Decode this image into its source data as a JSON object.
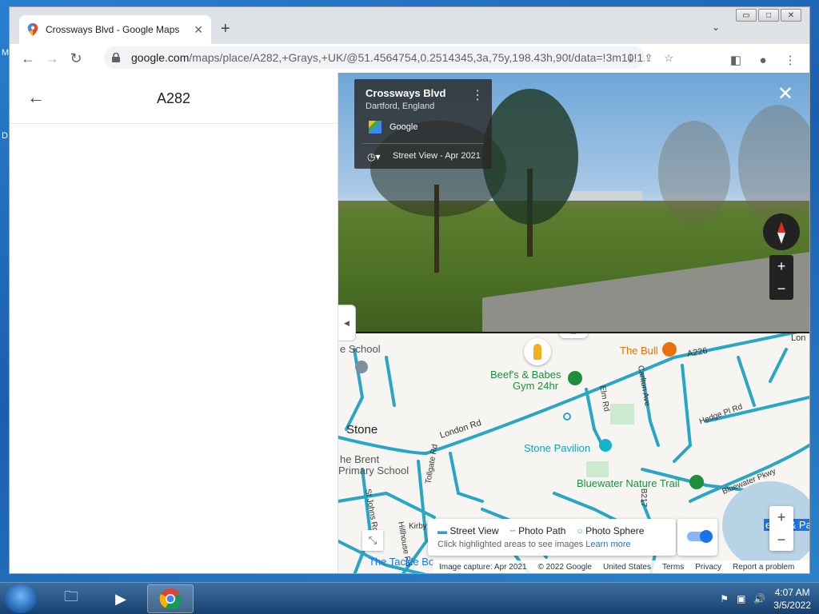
{
  "desktop": {
    "letters": [
      "M",
      "D"
    ]
  },
  "browser": {
    "tab_title": "Crossways Blvd - Google Maps",
    "tab_close": "✕",
    "new_tab": "+",
    "url_host": "google.com",
    "url_path": "/maps/place/A282,+Grays,+UK/@51.4564754,0.2514345,3a,75y,198.43h,90t/data=!3m10!1...",
    "window_buttons": [
      "▭",
      "□",
      "✕"
    ]
  },
  "left_panel": {
    "title": "A282"
  },
  "street_view": {
    "place_name": "Crossways Blvd",
    "place_location": "Dartford, England",
    "provider": "Google",
    "capture_label": "Street View - Apr 2021"
  },
  "map": {
    "labels": {
      "school": "e School",
      "the_bull": "The Bull",
      "a226": "A226",
      "lon": "Lon",
      "beefs": "Beef's & Babes",
      "gym": "Gym 24hr",
      "stone": "Stone",
      "london_rd": "London Rd",
      "elm_rd": "Elm Rd",
      "carlton_ave": "Carlton Ave",
      "hedge_pl_rd": "Hedge Pl Rd",
      "stone_pavilion": "Stone Pavilion",
      "brent": "he Brent",
      "primary_school": "Primary School",
      "tollgate_rd": "Tollgate Rd",
      "st_johns_rd": "St Johns Rd",
      "bluewater_trail": "Bluewater Nature Trail",
      "bluewater_pkwy": "Bluewater Pkwy",
      "b217": "B217",
      "kirby": "Kirby",
      "hillhouse_rd": "Hillhouse Rd",
      "lewis": "ewis & Pa",
      "tackle": "The Tackle Bo"
    },
    "layers": {
      "street_view": "Street View",
      "photo_path": "Photo Path",
      "photo_sphere": "Photo Sphere",
      "hint": "Click highlighted areas to see images",
      "learn_more": "Learn more"
    },
    "footer": [
      "Image capture: Apr 2021",
      "© 2022 Google",
      "United States",
      "Terms",
      "Privacy",
      "Report a problem"
    ]
  },
  "taskbar": {
    "time": "4:07 AM",
    "date": "3/5/2022"
  },
  "colors": {
    "road": "#28a6c3",
    "accent": "#1a73e8",
    "poi_green": "#1e8e3e",
    "poi_orange": "#e8710a"
  }
}
